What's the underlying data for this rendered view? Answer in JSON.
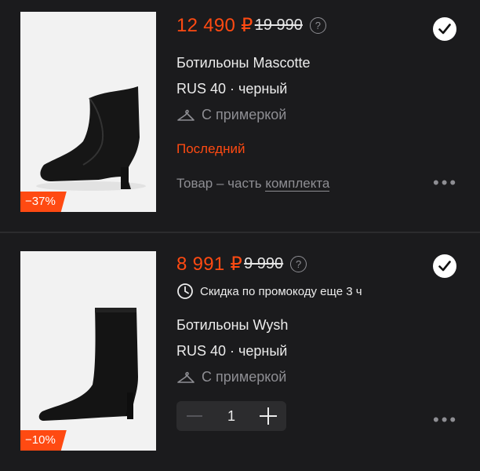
{
  "items": [
    {
      "price": "12 490 ₽",
      "old_price": "19 990",
      "help_icon": "question-circle-icon",
      "name": "Ботильоны Mascotte",
      "size_color": "RUS 40 · черный",
      "fitting": "С примеркой",
      "status": "Последний",
      "kit_prefix": "Товар – часть ",
      "kit_link": "комплекта",
      "discount_badge": "−37%",
      "selected": true
    },
    {
      "price": "8 991 ₽",
      "old_price": "9 990",
      "help_icon": "question-circle-icon",
      "promo": "Скидка по промокоду еще 3 ч",
      "name": "Ботильоны Wysh",
      "size_color": "RUS 40 · черный",
      "fitting": "С примеркой",
      "quantity": "1",
      "discount_badge": "−10%",
      "selected": true
    }
  ],
  "colors": {
    "accent": "#ff4a12",
    "background": "#1b1b1d",
    "muted": "#8e8e93"
  }
}
